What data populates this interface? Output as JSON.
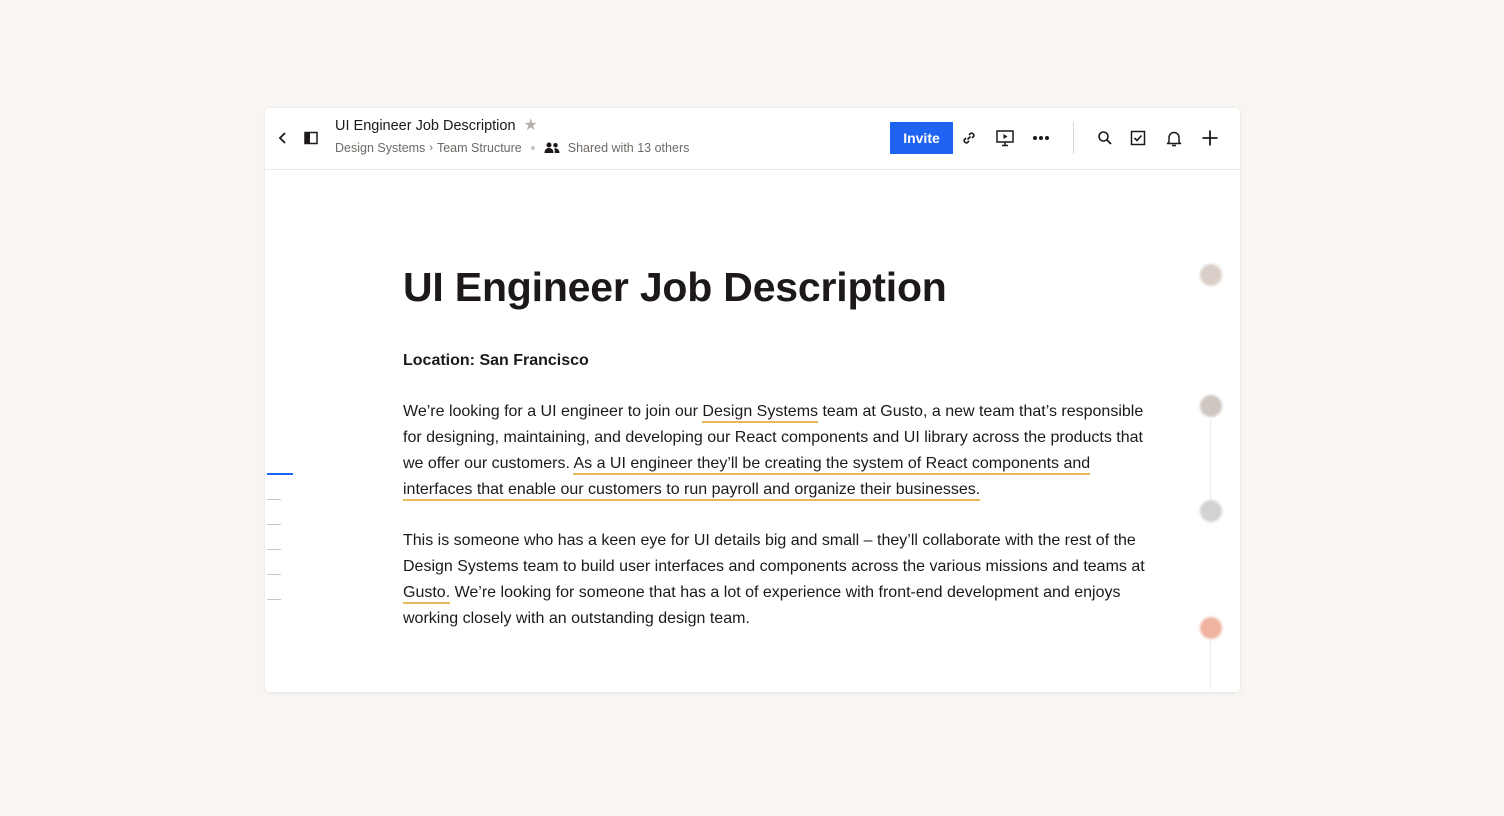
{
  "header": {
    "doc_title": "UI Engineer Job Description",
    "breadcrumb": [
      "Design Systems",
      "Team Structure"
    ],
    "shared_text": "Shared with 13 others",
    "invite_label": "Invite"
  },
  "icons": {
    "back": "chevron-left-icon",
    "sidebar_toggle": "sidebar-toggle-icon",
    "favorite": "star-icon",
    "people": "people-icon",
    "link": "link-icon",
    "present": "present-icon",
    "more": "more-icon",
    "search": "search-icon",
    "tasks": "checkbox-icon",
    "notifications": "bell-icon",
    "add": "plus-icon"
  },
  "document": {
    "title": "UI Engineer Job Description",
    "location": "Location: San Francisco",
    "p1": {
      "a": "We’re looking for a UI engineer to join our ",
      "b": "Design Systems",
      "c": " team at Gusto, a new team that’s responsible for designing, maintaining, and developing our React components and UI library across the products that we offer our customers. ",
      "d": "As a UI engineer they’ll be creating the system of React components and interfaces that enable our customers to run payroll and organize their businesses."
    },
    "p2": {
      "a": "This is someone who has a keen eye for UI details big and small – they’ll collaborate with the rest of the Design Systems team to build user interfaces and components across the various missions and teams at ",
      "b": "Gusto.",
      "c": " We’re looking for someone that has a lot of experience with front-end development and enjoys working closely with an outstanding design team."
    }
  },
  "colors": {
    "accent": "#1f63f2",
    "highlight_underline": "#e9b65c",
    "background": "#f8f5f2"
  }
}
